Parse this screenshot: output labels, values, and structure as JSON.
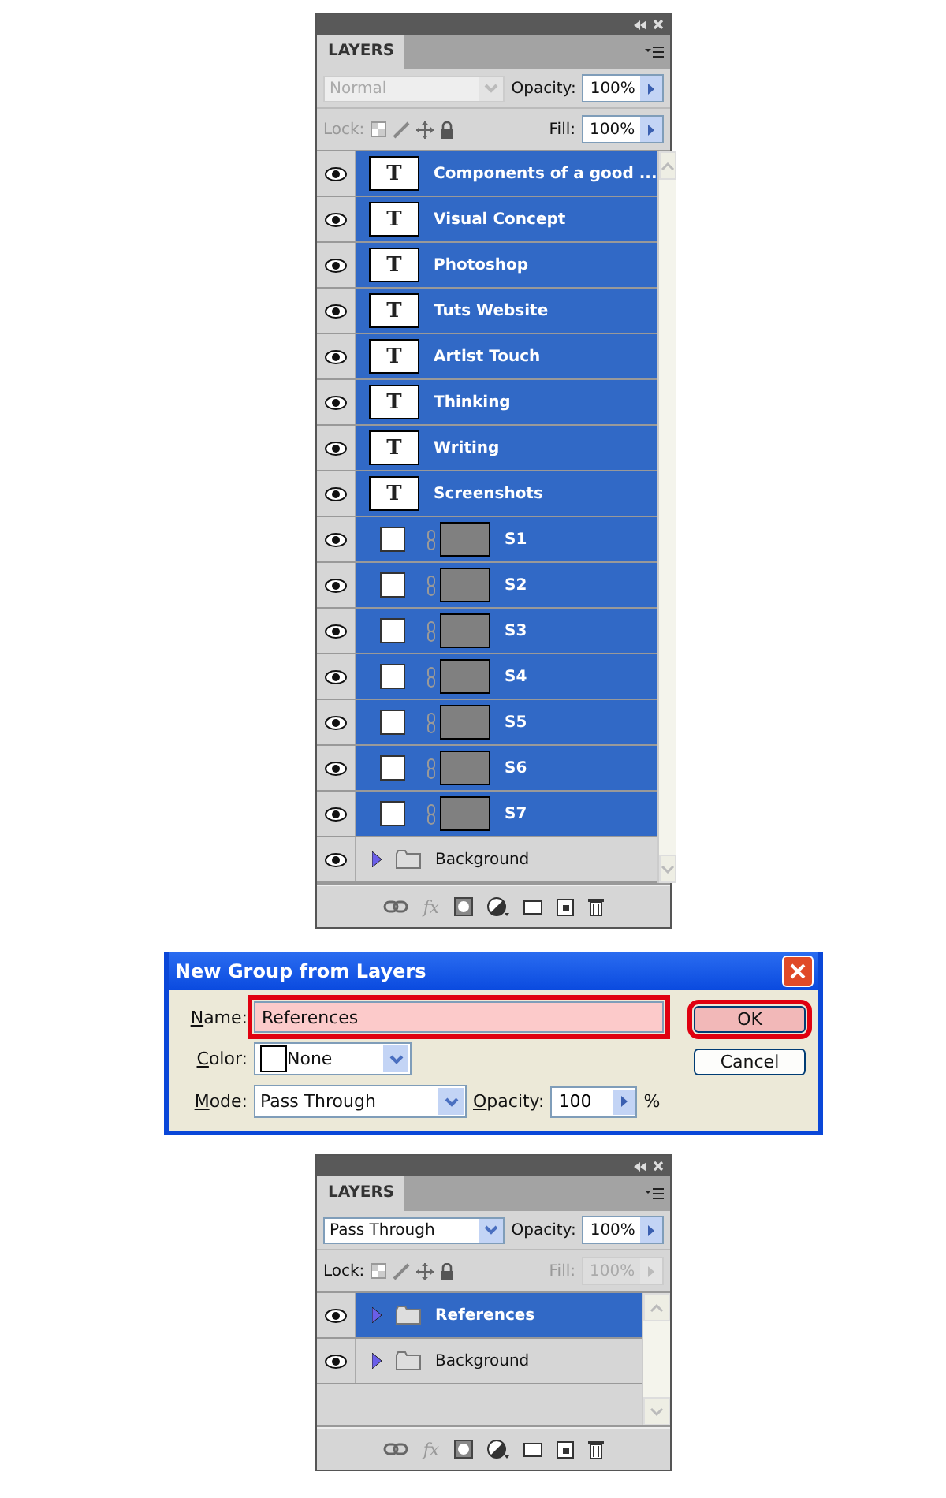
{
  "panels": [
    {
      "tab": "LAYERS",
      "blend": {
        "value": "Normal",
        "disabled": true
      },
      "opacity_label": "Opacity:",
      "opacity": "100%",
      "lock_label": "Lock:",
      "lock_disabled": true,
      "fill_label": "Fill:",
      "fill": "100%",
      "fill_disabled": false,
      "layers": [
        {
          "kind": "text",
          "glyph": "T",
          "name": "Components of a good ...",
          "selected": true
        },
        {
          "kind": "text",
          "glyph": "T",
          "name": "Visual Concept",
          "selected": true
        },
        {
          "kind": "text",
          "glyph": "T",
          "name": "Photoshop",
          "selected": true
        },
        {
          "kind": "text",
          "glyph": "T",
          "name": "Tuts Website",
          "selected": true
        },
        {
          "kind": "text",
          "glyph": "T",
          "name": "Artist Touch",
          "selected": true
        },
        {
          "kind": "text",
          "glyph": "T",
          "name": "Thinking",
          "selected": true
        },
        {
          "kind": "text",
          "glyph": "T",
          "name": "Writing",
          "selected": true
        },
        {
          "kind": "text",
          "glyph": "T",
          "name": "Screenshots",
          "selected": true
        },
        {
          "kind": "shape",
          "name": "S1",
          "selected": true
        },
        {
          "kind": "shape",
          "name": "S2",
          "selected": true
        },
        {
          "kind": "shape",
          "name": "S3",
          "selected": true
        },
        {
          "kind": "shape",
          "name": "S4",
          "selected": true
        },
        {
          "kind": "shape",
          "name": "S5",
          "selected": true
        },
        {
          "kind": "shape",
          "name": "S6",
          "selected": true
        },
        {
          "kind": "shape",
          "name": "S7",
          "selected": true
        },
        {
          "kind": "group",
          "name": "Background",
          "selected": false
        }
      ],
      "fx": "fx"
    },
    {
      "tab": "LAYERS",
      "blend": {
        "value": "Pass Through",
        "disabled": false
      },
      "opacity_label": "Opacity:",
      "opacity": "100%",
      "lock_label": "Lock:",
      "lock_disabled": false,
      "fill_label": "Fill:",
      "fill": "100%",
      "fill_disabled": true,
      "layers": [
        {
          "kind": "group",
          "name": "References",
          "selected": true
        },
        {
          "kind": "group",
          "name": "Background",
          "selected": false
        }
      ],
      "fx": "fx"
    }
  ],
  "dialog": {
    "title": "New Group from Layers",
    "name_label": "Name:",
    "name_value": "References",
    "name_highlighted": true,
    "color_label": "Color:",
    "color_value": "None",
    "mode_label": "Mode:",
    "mode_value": "Pass Through",
    "opacity_label": "Opacity:",
    "opacity_value": "100",
    "percent": "%",
    "buttons": [
      {
        "label": "OK",
        "highlighted": true
      },
      {
        "label": "Cancel",
        "highlighted": false
      }
    ]
  }
}
